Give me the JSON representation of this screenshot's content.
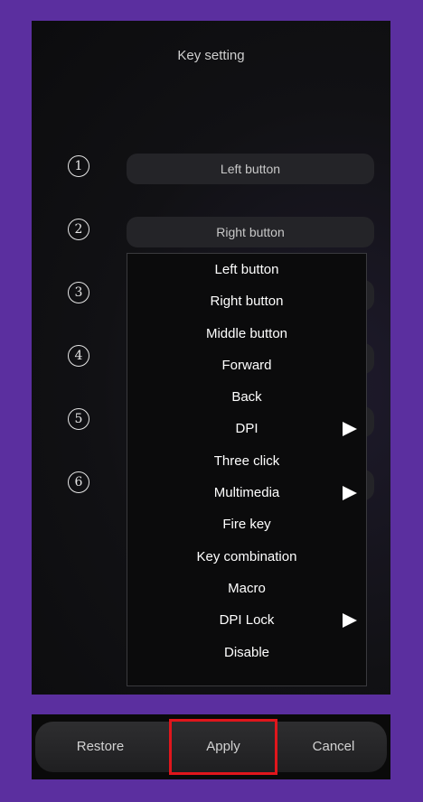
{
  "dialog": {
    "title": "Key setting",
    "keys": [
      {
        "number": "1",
        "label": "Left button"
      },
      {
        "number": "2",
        "label": "Right button"
      },
      {
        "number": "3",
        "label": ""
      },
      {
        "number": "4",
        "label": ""
      },
      {
        "number": "5",
        "label": ""
      },
      {
        "number": "6",
        "label": ""
      }
    ]
  },
  "dropdown": {
    "items": [
      {
        "label": "Left button",
        "submenu": false
      },
      {
        "label": "Right button",
        "submenu": false
      },
      {
        "label": "Middle button",
        "submenu": false
      },
      {
        "label": "Forward",
        "submenu": false
      },
      {
        "label": "Back",
        "submenu": false
      },
      {
        "label": "DPI",
        "submenu": true
      },
      {
        "label": "Three click",
        "submenu": false
      },
      {
        "label": "Multimedia",
        "submenu": true
      },
      {
        "label": "Fire key",
        "submenu": false
      },
      {
        "label": "Key combination",
        "submenu": false
      },
      {
        "label": "Macro",
        "submenu": false
      },
      {
        "label": "DPI Lock",
        "submenu": true
      },
      {
        "label": "Disable",
        "submenu": false
      }
    ]
  },
  "footer": {
    "restore_label": "Restore",
    "apply_label": "Apply",
    "cancel_label": "Cancel"
  },
  "colors": {
    "frame": "#5b2f9f",
    "highlight": "#e0161c"
  }
}
